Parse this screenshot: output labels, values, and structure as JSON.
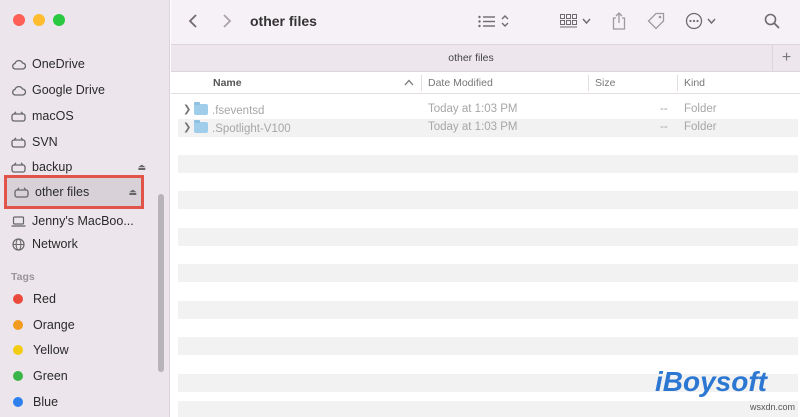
{
  "window": {
    "title": "other files",
    "tab_title": "other files"
  },
  "traffic_lights": {
    "close": "#fe5f57",
    "minimize": "#febc2e",
    "maximize": "#28c840"
  },
  "sidebar": {
    "items": [
      {
        "label": "OneDrive",
        "icon": "cloud-icon"
      },
      {
        "label": "Google Drive",
        "icon": "cloud-icon"
      },
      {
        "label": "macOS",
        "icon": "drive-icon"
      },
      {
        "label": "SVN",
        "icon": "drive-icon"
      },
      {
        "label": "backup",
        "icon": "drive-icon",
        "eject": true
      },
      {
        "label": "other files",
        "icon": "drive-icon",
        "eject": true,
        "selected": true
      },
      {
        "label": "Jenny's MacBoo...",
        "icon": "laptop-icon"
      },
      {
        "label": "Network",
        "icon": "globe-icon"
      }
    ],
    "tags_title": "Tags",
    "tags": [
      {
        "label": "Red",
        "color": "#ea4a3c"
      },
      {
        "label": "Orange",
        "color": "#f29c1f"
      },
      {
        "label": "Yellow",
        "color": "#f2cc12"
      },
      {
        "label": "Green",
        "color": "#39b54a"
      },
      {
        "label": "Blue",
        "color": "#2f80ed"
      }
    ]
  },
  "toolbar": {
    "back_icon": "chevron-left-icon",
    "forward_icon": "chevron-right-icon",
    "view_icon": "list-view-icon",
    "group_icon": "group-grid-icon",
    "share_icon": "share-icon",
    "tag_icon": "tag-icon",
    "action_icon": "more-icon",
    "search_icon": "search-icon",
    "new_tab": "+"
  },
  "columns": {
    "name": "Name",
    "date": "Date Modified",
    "size": "Size",
    "kind": "Kind"
  },
  "files": [
    {
      "name": ".fseventsd",
      "date": "Today at 1:03 PM",
      "size": "--",
      "kind": "Folder"
    },
    {
      "name": ".Spotlight-V100",
      "date": "Today at 1:03 PM",
      "size": "--",
      "kind": "Folder"
    }
  ],
  "watermark": {
    "logo": "iBoysoft",
    "domain": "wsxdn.com"
  }
}
